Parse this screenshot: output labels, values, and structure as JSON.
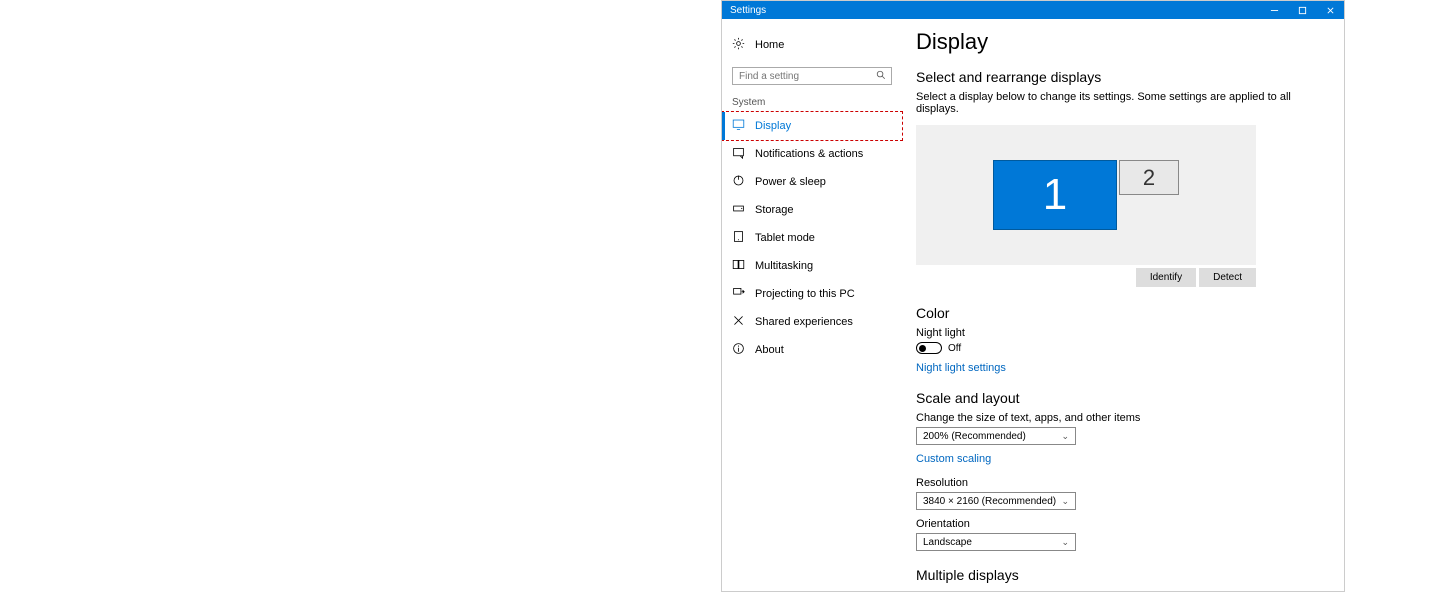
{
  "window": {
    "title": "Settings"
  },
  "sidebar": {
    "home": "Home",
    "search_placeholder": "Find a setting",
    "section": "System",
    "items": [
      {
        "label": "Display"
      },
      {
        "label": "Notifications & actions"
      },
      {
        "label": "Power & sleep"
      },
      {
        "label": "Storage"
      },
      {
        "label": "Tablet mode"
      },
      {
        "label": "Multitasking"
      },
      {
        "label": "Projecting to this PC"
      },
      {
        "label": "Shared experiences"
      },
      {
        "label": "About"
      }
    ]
  },
  "main": {
    "title": "Display",
    "select_rearrange": "Select and rearrange displays",
    "select_desc": "Select a display below to change its settings. Some settings are applied to all displays.",
    "display1": "1",
    "display2": "2",
    "identify": "Identify",
    "detect": "Detect",
    "color": "Color",
    "night_light": "Night light",
    "night_light_state": "Off",
    "night_light_settings": "Night light settings",
    "scale_layout": "Scale and layout",
    "scale_desc": "Change the size of text, apps, and other items",
    "scale_value": "200% (Recommended)",
    "custom_scaling": "Custom scaling",
    "resolution": "Resolution",
    "resolution_value": "3840 × 2160 (Recommended)",
    "orientation": "Orientation",
    "orientation_value": "Landscape",
    "multiple_displays": "Multiple displays"
  }
}
